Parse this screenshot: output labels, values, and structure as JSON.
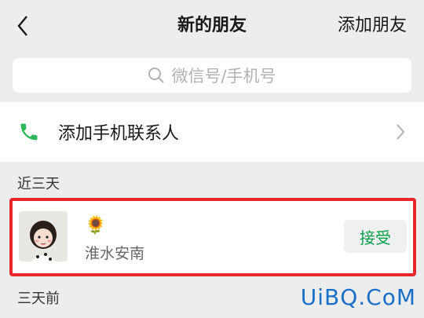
{
  "nav": {
    "back_icon": "chevron-left-icon",
    "title": "新的朋友",
    "action": "添加朋友"
  },
  "search": {
    "icon": "search-icon",
    "placeholder": "微信号/手机号"
  },
  "add_contacts": {
    "icon": "phone-icon",
    "label": "添加手机联系人",
    "chevron": "chevron-right-icon"
  },
  "sections": {
    "recent": "近三天",
    "earlier": "三天前"
  },
  "friend_requests": [
    {
      "emoji": "🌻",
      "name": "淮水安南",
      "button": "接受"
    }
  ],
  "watermark": "UiBQ.CoM",
  "colors": {
    "accent_green": "#07c160",
    "highlight_red": "#e8262b",
    "background": "#ededed"
  }
}
